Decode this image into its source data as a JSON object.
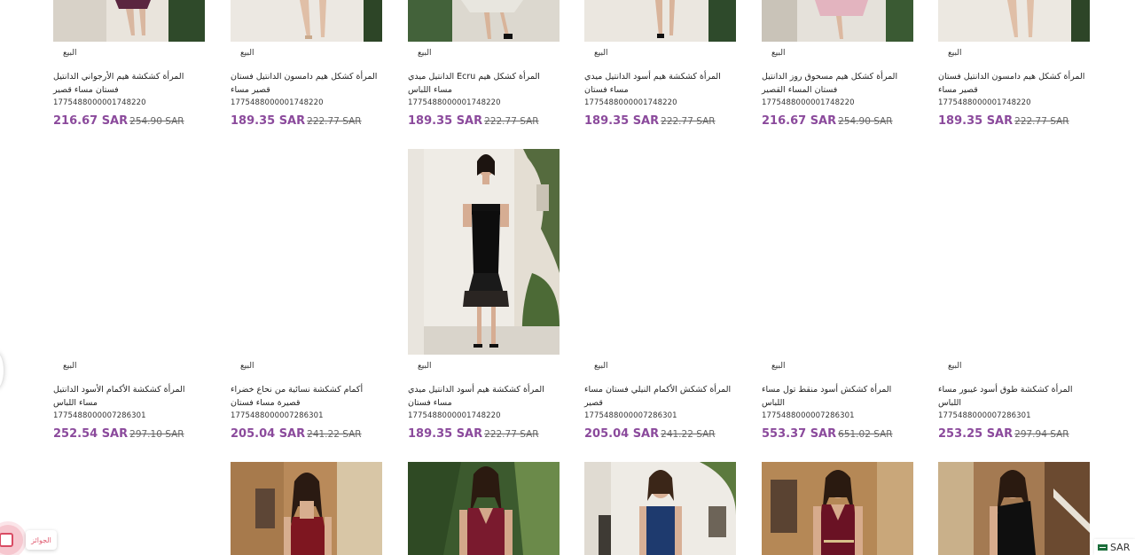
{
  "products": [
    {
      "badge": "البيع",
      "title": "المرأة كشكشة هيم الأرجواني الدانتيل فستان مساء قصير",
      "sku": "1775488000001748220",
      "price": "216.67 SAR",
      "old_price": "254.90 SAR"
    },
    {
      "badge": "البيع",
      "title": "المرأة كشكل هيم دامسون الدانتيل فستان قصير مساء",
      "sku": "1775488000001748220",
      "price": "189.35 SAR",
      "old_price": "222.77 SAR"
    },
    {
      "badge": "البيع",
      "title": "المرأة كشكل هيم Ecru الدانتيل ميدي مساء اللباس",
      "sku": "1775488000001748220",
      "price": "189.35 SAR",
      "old_price": "222.77 SAR"
    },
    {
      "badge": "البيع",
      "title": "المرأة كشكشة هيم أسود الدانتيل ميدي مساء فستان",
      "sku": "1775488000001748220",
      "price": "189.35 SAR",
      "old_price": "222.77 SAR"
    },
    {
      "badge": "البيع",
      "title": "المرأة كشكل هيم مسحوق روز الدانتيل فستان المساء القصير",
      "sku": "1775488000001748220",
      "price": "216.67 SAR",
      "old_price": "254.90 SAR"
    },
    {
      "badge": "البيع",
      "title": "المرأة كشكل هيم دامسون الدانتيل فستان قصير مساء",
      "sku": "1775488000001748220",
      "price": "189.35 SAR",
      "old_price": "222.77 SAR"
    },
    {
      "badge": "البيع",
      "title": "المرأة كشكشة الأكمام الأسود الدانتيل مساء اللباس",
      "sku": "1775488000007286301",
      "price": "252.54 SAR",
      "old_price": "297.10 SAR"
    },
    {
      "badge": "البيع",
      "title": "أكمام كشكشة نسائية من نحاع خضراء قصيرة مساء فستان",
      "sku": "1775488000007286301",
      "price": "205.04 SAR",
      "old_price": "241.22 SAR"
    },
    {
      "badge": "البيع",
      "title": "المرأة كشكشة هيم أسود الدانتيل ميدي مساء فستان",
      "sku": "1775488000001748220",
      "price": "189.35 SAR",
      "old_price": "222.77 SAR"
    },
    {
      "badge": "البيع",
      "title": "المرأة كشكش الأكمام النيلي فستان مساء قصير",
      "sku": "1775488000007286301",
      "price": "205.04 SAR",
      "old_price": "241.22 SAR"
    },
    {
      "badge": "البيع",
      "title": "المرأة كشكش أسود منقط تول مساء اللباس",
      "sku": "1775488000007286301",
      "price": "553.37 SAR",
      "old_price": "651.02 SAR"
    },
    {
      "badge": "البيع",
      "title": "المرأة كشكشة طوق أسود غيبور مساء اللباس",
      "sku": "1775488000007286301",
      "price": "253.25 SAR",
      "old_price": "297.94 SAR"
    }
  ],
  "floating_widget": {
    "label": "الجوائز"
  },
  "currency": {
    "code": "SAR"
  },
  "colors": {
    "price": "#8b4a9c",
    "widget": "#d94b63"
  }
}
